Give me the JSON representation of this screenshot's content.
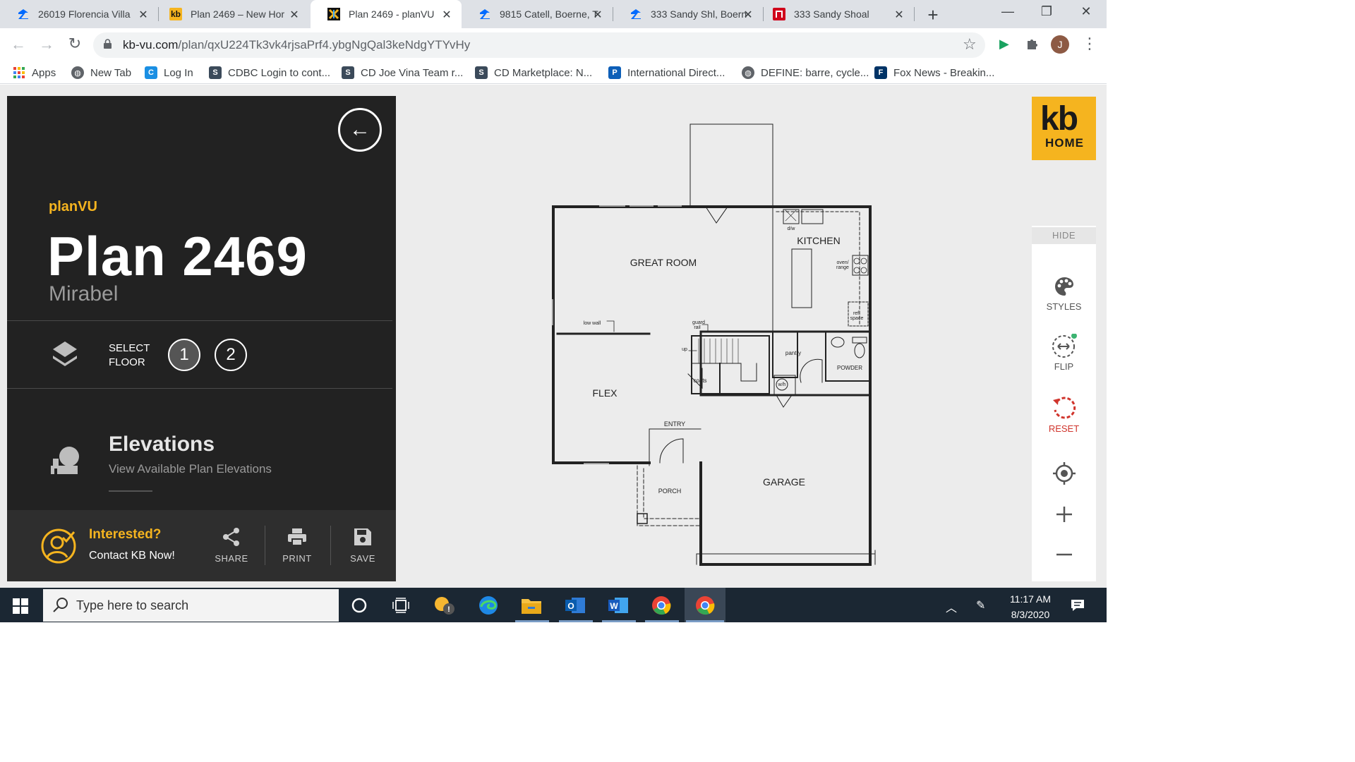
{
  "browser": {
    "tabs": [
      {
        "title": "26019 Florencia Villa",
        "icon": "zillow-z-icon",
        "active": false
      },
      {
        "title": "Plan 2469 – New Hor",
        "icon": "kb-favicon",
        "active": false
      },
      {
        "title": "Plan 2469 - planVU",
        "icon": "planvu-favicon",
        "active": true
      },
      {
        "title": "9815 Catell, Boerne, T",
        "icon": "zillow-z-icon",
        "active": false
      },
      {
        "title": "333 Sandy Shl, Boern",
        "icon": "zillow-z-icon",
        "active": false
      },
      {
        "title": "333 Sandy Shoal",
        "icon": "red-favicon",
        "active": false
      }
    ],
    "url_host": "kb-vu.com",
    "url_path": "/plan/qxU224Tk3vk4rjsaPrf4.ybgNgQal3keNdgYTYvHy",
    "profile_initial": "J",
    "bookmarks": [
      {
        "label": "Apps",
        "icon": "apps-grid-icon"
      },
      {
        "label": "New Tab",
        "icon": "globe-icon"
      },
      {
        "label": "Log In",
        "icon": "c-favicon"
      },
      {
        "label": "CDBC Login to cont...",
        "icon": "cdbc-favicon"
      },
      {
        "label": "CD Joe Vina Team r...",
        "icon": "cdbc-favicon"
      },
      {
        "label": "CD Marketplace: N...",
        "icon": "cdbc-favicon"
      },
      {
        "label": "International Direct...",
        "icon": "p-favicon"
      },
      {
        "label": "DEFINE: barre, cycle...",
        "icon": "globe-icon"
      },
      {
        "label": "Fox News - Breakin...",
        "icon": "fox-favicon"
      }
    ]
  },
  "panel": {
    "brand": "planVU",
    "plan_title": "Plan 2469",
    "plan_subtitle": "Mirabel",
    "select_floor_label_1": "SELECT",
    "select_floor_label_2": "FLOOR",
    "floors": [
      "1",
      "2"
    ],
    "active_floor": "1",
    "elevations_title": "Elevations",
    "elevations_subtitle": "View Available Plan Elevations",
    "interested_title": "Interested?",
    "interested_subtitle": "Contact KB Now!",
    "actions": {
      "share": "SHARE",
      "print": "PRINT",
      "save": "SAVE"
    }
  },
  "floorplan": {
    "rooms": {
      "great_room": "GREAT ROOM",
      "kitchen": "KITCHEN",
      "flex": "FLEX",
      "garage": "GARAGE",
      "entry": "ENTRY",
      "porch": "PORCH",
      "pantry": "pantry",
      "powder": "POWDER",
      "coats": "coats",
      "wh": "w/h",
      "dw": "d/w",
      "oven_range_1": "oven/",
      "oven_range_2": "range",
      "ref_space_1": "ref.",
      "ref_space_2": "space",
      "low_wall": "low wall",
      "guard_rail_1": "guard",
      "guard_rail_2": "rail",
      "up": "up"
    }
  },
  "rail": {
    "logo_top": "kb",
    "logo_bottom": "HOME",
    "hide": "HIDE",
    "styles": "STYLES",
    "flip": "FLIP",
    "reset": "RESET"
  },
  "taskbar": {
    "search_placeholder": "Type here to search",
    "time": "11:17 AM",
    "date": "8/3/2020"
  },
  "colors": {
    "accent": "#f5b41f",
    "panel_bg": "#222222",
    "reset_red": "#d0342c"
  }
}
